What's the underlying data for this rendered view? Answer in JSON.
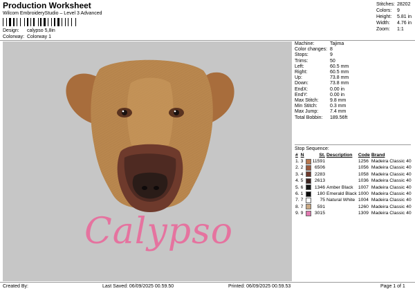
{
  "header": {
    "title": "Production Worksheet",
    "software": "Wilcom EmbroideryStudio – Level 3 Advanced",
    "design_label": "Design:",
    "design_value": "calypso 5,8in",
    "colorway_label": "Colorway:",
    "colorway_value": "Colorway 1"
  },
  "stats": [
    {
      "label": "Stitches:",
      "value": "28202"
    },
    {
      "label": "Colors:",
      "value": "9"
    },
    {
      "label": "Height:",
      "value": "5.81 in"
    },
    {
      "label": "Width:",
      "value": "4.76 in"
    },
    {
      "label": "Zoom:",
      "value": "1:1"
    }
  ],
  "machine": [
    {
      "label": "Machine:",
      "value": "Tajima"
    },
    {
      "label": "Color changes:",
      "value": "8"
    },
    {
      "label": "Stops:",
      "value": "9"
    },
    {
      "label": "Trims:",
      "value": "50"
    },
    {
      "label": "Left:",
      "value": "60.5 mm"
    },
    {
      "label": "Right:",
      "value": "60.5 mm"
    },
    {
      "label": "Up:",
      "value": "73.8 mm"
    },
    {
      "label": "Down:",
      "value": "73.8 mm"
    },
    {
      "label": "EndX:",
      "value": "0.00 in"
    },
    {
      "label": "EndY:",
      "value": "0.00 in"
    },
    {
      "label": "Max Stitch:",
      "value": "9.8 mm"
    },
    {
      "label": "Min Stitch:",
      "value": "0.3 mm"
    },
    {
      "label": "Max Jump:",
      "value": "7.4 mm"
    },
    {
      "label": "Total Bobbin:",
      "value": "189.56ft"
    }
  ],
  "stop_sequence": {
    "title": "Stop Sequence:",
    "headers": {
      "n": "#",
      "n1": "N",
      "stitch": "St.",
      "description": "Description",
      "code": "Code",
      "brand": "Brand"
    },
    "rows": [
      {
        "n": "1.",
        "n1": "3",
        "color": "#b8774f",
        "stitches": "11591",
        "description": "",
        "code": "1256",
        "brand": "Madeira Classic 40"
      },
      {
        "n": "2.",
        "n1": "2",
        "color": "#9a5a3e",
        "stitches": "6506",
        "description": "",
        "code": "1056",
        "brand": "Madeira Classic 40"
      },
      {
        "n": "3.",
        "n1": "4",
        "color": "#6e3a2c",
        "stitches": "2283",
        "description": "",
        "code": "1058",
        "brand": "Madeira Classic 40"
      },
      {
        "n": "4.",
        "n1": "5",
        "color": "#3d2420",
        "stitches": "2613",
        "description": "",
        "code": "1036",
        "brand": "Madeira Classic 40"
      },
      {
        "n": "5.",
        "n1": "6",
        "color": "#161616",
        "stitches": "1346",
        "description": "Amber Black",
        "code": "1007",
        "brand": "Madeira Classic 40"
      },
      {
        "n": "6.",
        "n1": "1",
        "color": "#0a0a0a",
        "stitches": "180",
        "description": "Emerald Black",
        "code": "1000",
        "brand": "Madeira Classic 40"
      },
      {
        "n": "7.",
        "n1": "7",
        "color": "#ffffff",
        "stitches": "75",
        "description": "Natural White",
        "code": "1004",
        "brand": "Madeira Classic 40"
      },
      {
        "n": "8.",
        "n1": "7",
        "color": "#c9a883",
        "stitches": "591",
        "description": "",
        "code": "1260",
        "brand": "Madeira Classic 40"
      },
      {
        "n": "9.",
        "n1": "9",
        "color": "#e07ab0",
        "stitches": "3015",
        "description": "",
        "code": "1309",
        "brand": "Madeira Classic 40"
      }
    ]
  },
  "design": {
    "text": "Calypso",
    "text_color": "#e5739f",
    "background": "#c6c6c6"
  },
  "footer": {
    "created_by": "Created By:",
    "last_saved": "Last Saved: 06/09/2025 00.59.50",
    "printed": "Printed: 06/09/2025 00.59.53",
    "page": "Page 1 of 1"
  }
}
